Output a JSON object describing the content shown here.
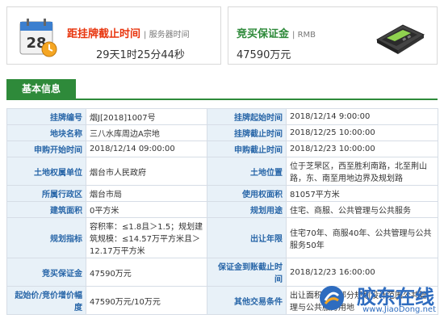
{
  "deadline": {
    "title": "距挂牌截止时间",
    "subtitle": "服务器时间",
    "countdown": "29天1时25分44秒",
    "icon": "calendar-icon",
    "calendar_number": "28"
  },
  "deposit": {
    "title": "竞买保证金",
    "subtitle": "RMB",
    "amount": "47590万元",
    "icon": "pos-terminal-icon"
  },
  "section": {
    "tab_label": "基本信息"
  },
  "rows": [
    {
      "l1": "挂牌编号",
      "v1": "烟J[2018]1007号",
      "l2": "挂牌起始时间",
      "v2": "2018/12/14 9:00:00"
    },
    {
      "l1": "地块名称",
      "v1": "三八水库周边A宗地",
      "l2": "挂牌截止时间",
      "v2": "2018/12/25 10:00:00"
    },
    {
      "l1": "申购开始时间",
      "v1": "2018/12/14 09:00:00",
      "l2": "申购截止时间",
      "v2": "2018/12/23 10:00:00"
    },
    {
      "l1": "土地权属单位",
      "v1": "烟台市人民政府",
      "l2": "土地位置",
      "v2": "位于芝罘区，西至胜利南路，北至荆山路，东、南至用地边界及规划路"
    },
    {
      "l1": "所属行政区",
      "v1": "烟台市局",
      "l2": "使用权面积",
      "v2": "81057平方米"
    },
    {
      "l1": "建筑面积",
      "v1": "0平方米",
      "l2": "规划用途",
      "v2": "住宅、商服、公共管理与公共服务"
    },
    {
      "l1": "规划指标",
      "v1": "容积率：≤1.8且＞1.5；规划建筑规模：≤14.57万平方米且＞12.17万平方米",
      "l2": "出让年限",
      "v2": "住宅70年、商服40年、公共管理与公共服务50年"
    },
    {
      "l1": "竞买保证金",
      "v1": "47590万元",
      "l2": "保证金到账截止时间",
      "v2": "2018/12/23 16:00:00"
    },
    {
      "l1": "起始价/竞价增价幅度",
      "v1": "47590万元/10万元",
      "l2": "其他交易条件",
      "v2": "出让面积中含部分规划设计范围公共管理与公共服务用地"
    }
  ],
  "watermark": {
    "text": "胶东在线",
    "url": "www.JiaoDong.net"
  },
  "colors": {
    "accent_red": "#e8340c",
    "accent_green": "#2e8a3a",
    "label_blue": "#2866a8",
    "label_bg": "#e8f1f8"
  }
}
